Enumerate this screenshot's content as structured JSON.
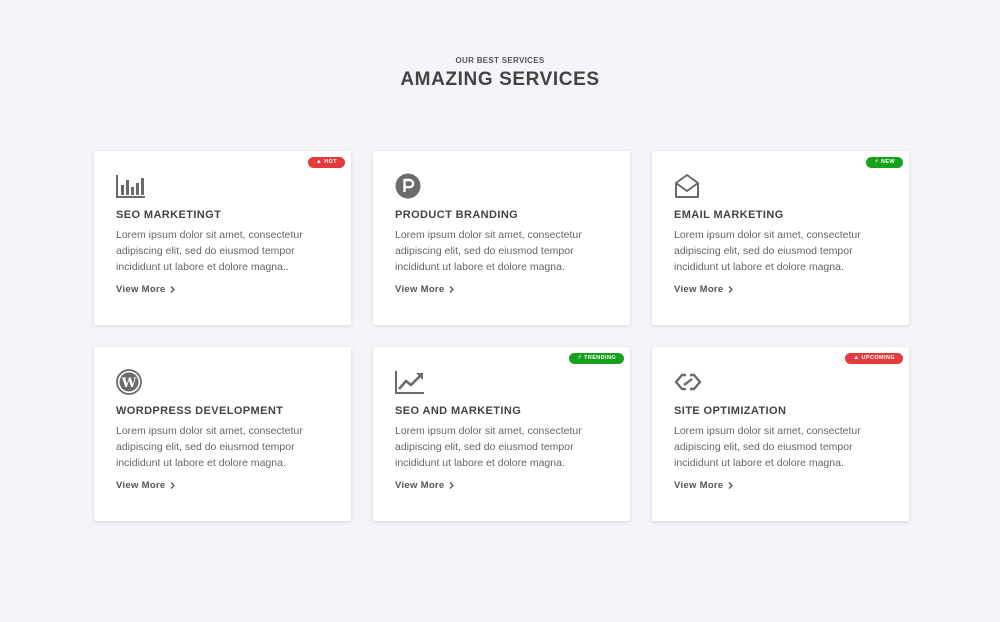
{
  "header": {
    "eyebrow": "OUR BEST SERVICES",
    "title": "AMAZING SERVICES"
  },
  "colors": {
    "hot": "#e33b3b",
    "new": "#16a31b",
    "trending": "#16a31b",
    "upcoming": "#e33b3b",
    "icon": "#6b6b6b"
  },
  "cards": [
    {
      "icon": "bar-chart-icon",
      "badge": {
        "label": "HOT",
        "glyph": "fire-icon",
        "color": "#e33b3b"
      },
      "title": "SEO MARKETINGT",
      "description": "Lorem ipsum dolor sit amet, consectetur adipiscing elit, sed do eiusmod tempor incididunt ut labore et dolore magna..",
      "link": "View More"
    },
    {
      "icon": "parking-circle-icon",
      "badge": null,
      "title": "PRODUCT BRANDING",
      "description": "Lorem ipsum dolor sit amet, consectetur adipiscing elit, sed do eiusmod tempor incididunt ut labore et dolore magna.",
      "link": "View More"
    },
    {
      "icon": "open-envelope-icon",
      "badge": {
        "label": "NEW",
        "glyph": "bolt-icon",
        "color": "#16a31b"
      },
      "title": "EMAIL MARKETING",
      "description": "Lorem ipsum dolor sit amet, consectetur adipiscing elit, sed do eiusmod tempor incididunt ut labore et dolore magna.",
      "link": "View More"
    },
    {
      "icon": "wordpress-icon",
      "badge": null,
      "title": "WORDPRESS DEVELOPMENT",
      "description": "Lorem ipsum dolor sit amet, consectetur adipiscing elit, sed do eiusmod tempor incididunt ut labore et dolore magna.",
      "link": "View More"
    },
    {
      "icon": "trend-up-icon",
      "badge": {
        "label": "TRENDING",
        "glyph": "bolt-icon",
        "color": "#16a31b"
      },
      "title": "SEO AND MARKETING",
      "description": "Lorem ipsum dolor sit amet, consectetur adipiscing elit, sed do eiusmod tempor incididunt ut labore et dolore magna.",
      "link": "View More"
    },
    {
      "icon": "link-icon",
      "badge": {
        "label": "UPCOMING",
        "glyph": "fire-icon",
        "color": "#e33b3b"
      },
      "title": "SITE OPTIMIZATION",
      "description": "Lorem ipsum dolor sit amet, consectetur adipiscing elit, sed do eiusmod tempor incididunt ut labore et dolore magna.",
      "link": "View More"
    }
  ]
}
